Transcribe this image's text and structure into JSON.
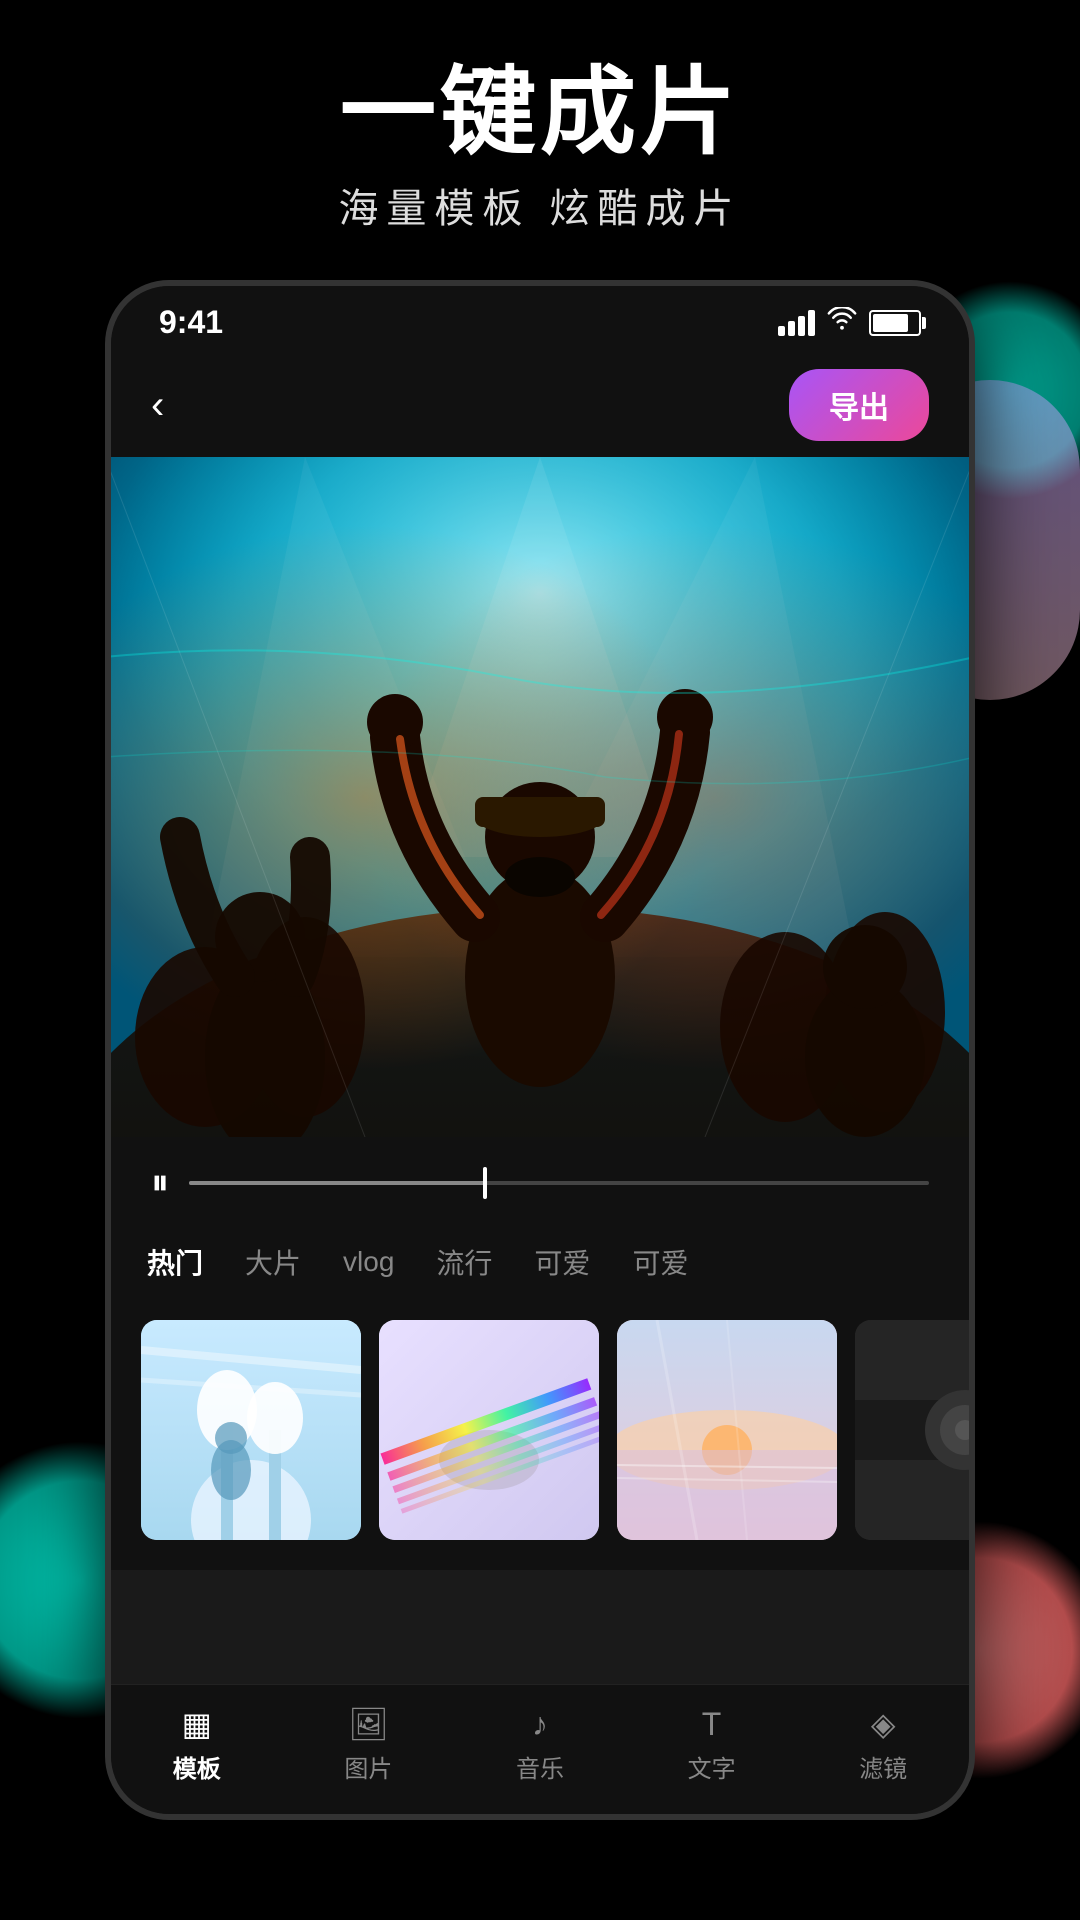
{
  "hero": {
    "title": "一键成片",
    "subtitle": "海量模板   炫酷成片"
  },
  "status_bar": {
    "time": "9:41",
    "signal_label": "signal",
    "wifi_label": "wifi",
    "battery_label": "battery"
  },
  "nav": {
    "back_label": "‹",
    "export_label": "导出"
  },
  "playback": {
    "pause_icon": "⏸"
  },
  "categories": {
    "items": [
      {
        "label": "热门",
        "active": true
      },
      {
        "label": "大片",
        "active": false
      },
      {
        "label": "vlog",
        "active": false
      },
      {
        "label": "流行",
        "active": false
      },
      {
        "label": "可爱",
        "active": false
      },
      {
        "label": "可爱",
        "active": false
      }
    ]
  },
  "bottom_tabs": {
    "items": [
      {
        "label": "模板",
        "active": true
      },
      {
        "label": "图片",
        "active": false
      },
      {
        "label": "音乐",
        "active": false
      },
      {
        "label": "文字",
        "active": false
      },
      {
        "label": "滤镜",
        "active": false
      }
    ]
  }
}
